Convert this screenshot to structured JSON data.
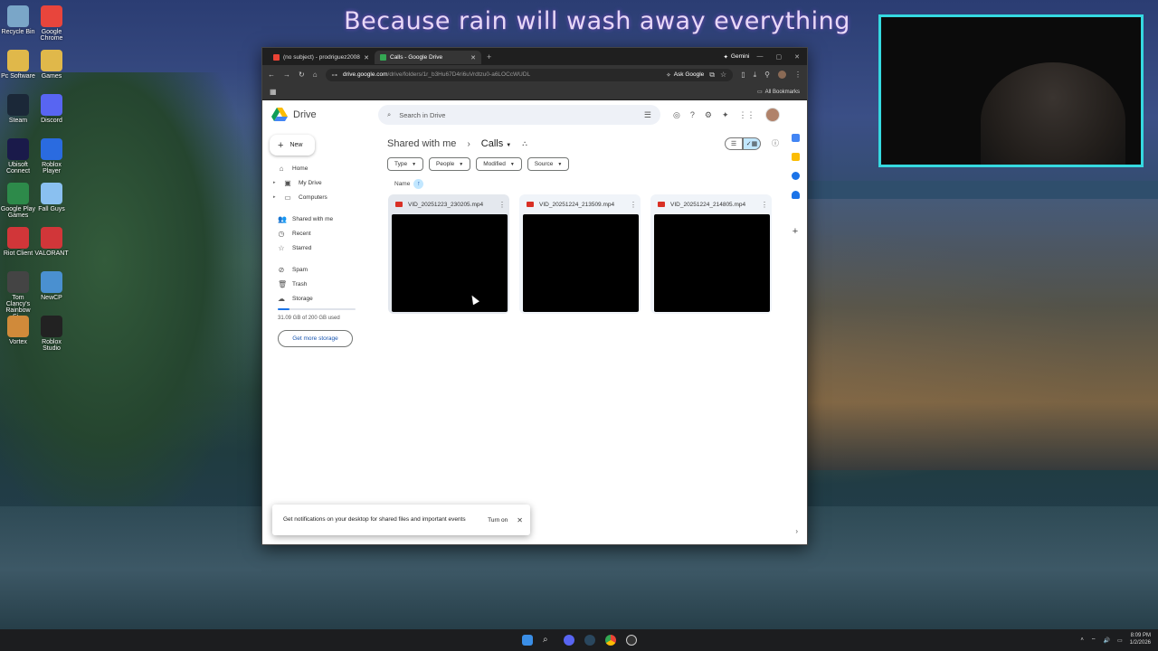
{
  "banner": "Because rain will wash away everything",
  "desktop_icons": [
    {
      "label": "Recycle Bin",
      "color": "#7aa6c8"
    },
    {
      "label": "Google Chrome",
      "color": "#e8453c"
    },
    {
      "label": "Pc Software",
      "color": "#e0b84a"
    },
    {
      "label": "Games",
      "color": "#e0b84a"
    },
    {
      "label": "Steam",
      "color": "#1b2838"
    },
    {
      "label": "Discord",
      "color": "#5865f2"
    },
    {
      "label": "Ubisoft Connect",
      "color": "#1a1a4a"
    },
    {
      "label": "Roblox Player",
      "color": "#2a6be0"
    },
    {
      "label": "Google Play Games",
      "color": "#2d8a4a"
    },
    {
      "label": "Fall Guys",
      "color": "#8ac0f0"
    },
    {
      "label": "Riot Client",
      "color": "#d13639"
    },
    {
      "label": "VALORANT",
      "color": "#d13639"
    },
    {
      "label": "Tom Clancy's Rainbow Si...",
      "color": "#444444"
    },
    {
      "label": "NewCP",
      "color": "#4a90d0"
    },
    {
      "label": "Vortex",
      "color": "#d08a3a"
    },
    {
      "label": "Roblox Studio",
      "color": "#222222"
    }
  ],
  "browser": {
    "tabs": [
      {
        "label": "(no subject) - prodriguez2008@...",
        "favicon_color": "#ea4335",
        "active": false
      },
      {
        "label": "Calls - Google Drive",
        "favicon_color": "#34a853",
        "active": true
      }
    ],
    "gemini_label": "Gemini",
    "url_domain": "drive.google.com",
    "url_path": "/drive/folders/1r_b3Hu67D4ri6uVrdtzu0-a6LOCcWUDL",
    "ask_google": "Ask Google",
    "all_bookmarks": "All Bookmarks"
  },
  "drive": {
    "app_name": "Drive",
    "search_placeholder": "Search in Drive",
    "new_label": "New",
    "nav": [
      {
        "label": "Home",
        "icon": "home-icon",
        "glyph": "⌂"
      },
      {
        "label": "My Drive",
        "icon": "my-drive-icon",
        "glyph": "▣"
      },
      {
        "label": "Computers",
        "icon": "computers-icon",
        "glyph": "▭"
      },
      {
        "label": "Shared with me",
        "icon": "shared-icon",
        "glyph": "👥"
      },
      {
        "label": "Recent",
        "icon": "recent-icon",
        "glyph": "◷"
      },
      {
        "label": "Starred",
        "icon": "star-icon",
        "glyph": "☆"
      },
      {
        "label": "Spam",
        "icon": "spam-icon",
        "glyph": "⊘"
      },
      {
        "label": "Trash",
        "icon": "trash-icon",
        "glyph": "🗑"
      },
      {
        "label": "Storage",
        "icon": "cloud-icon",
        "glyph": "☁"
      }
    ],
    "storage_text": "31.09 GB of 200 GB used",
    "storage_fraction": 0.155,
    "get_more_storage": "Get more storage",
    "breadcrumb": {
      "parent": "Shared with me",
      "current": "Calls"
    },
    "filters": [
      "Type",
      "People",
      "Modified",
      "Source"
    ],
    "sort_label": "Name",
    "files": [
      {
        "name": "VID_20251223_230205.mp4",
        "selected": true
      },
      {
        "name": "VID_20251224_213509.mp4",
        "selected": false
      },
      {
        "name": "VID_20251224_214805.mp4",
        "selected": false
      }
    ],
    "snackbar": {
      "text": "Get notifications on your desktop for shared files and important events",
      "button": "Turn on"
    }
  },
  "taskbar": {
    "time": "8:09 PM",
    "date": "1/2/2026"
  }
}
